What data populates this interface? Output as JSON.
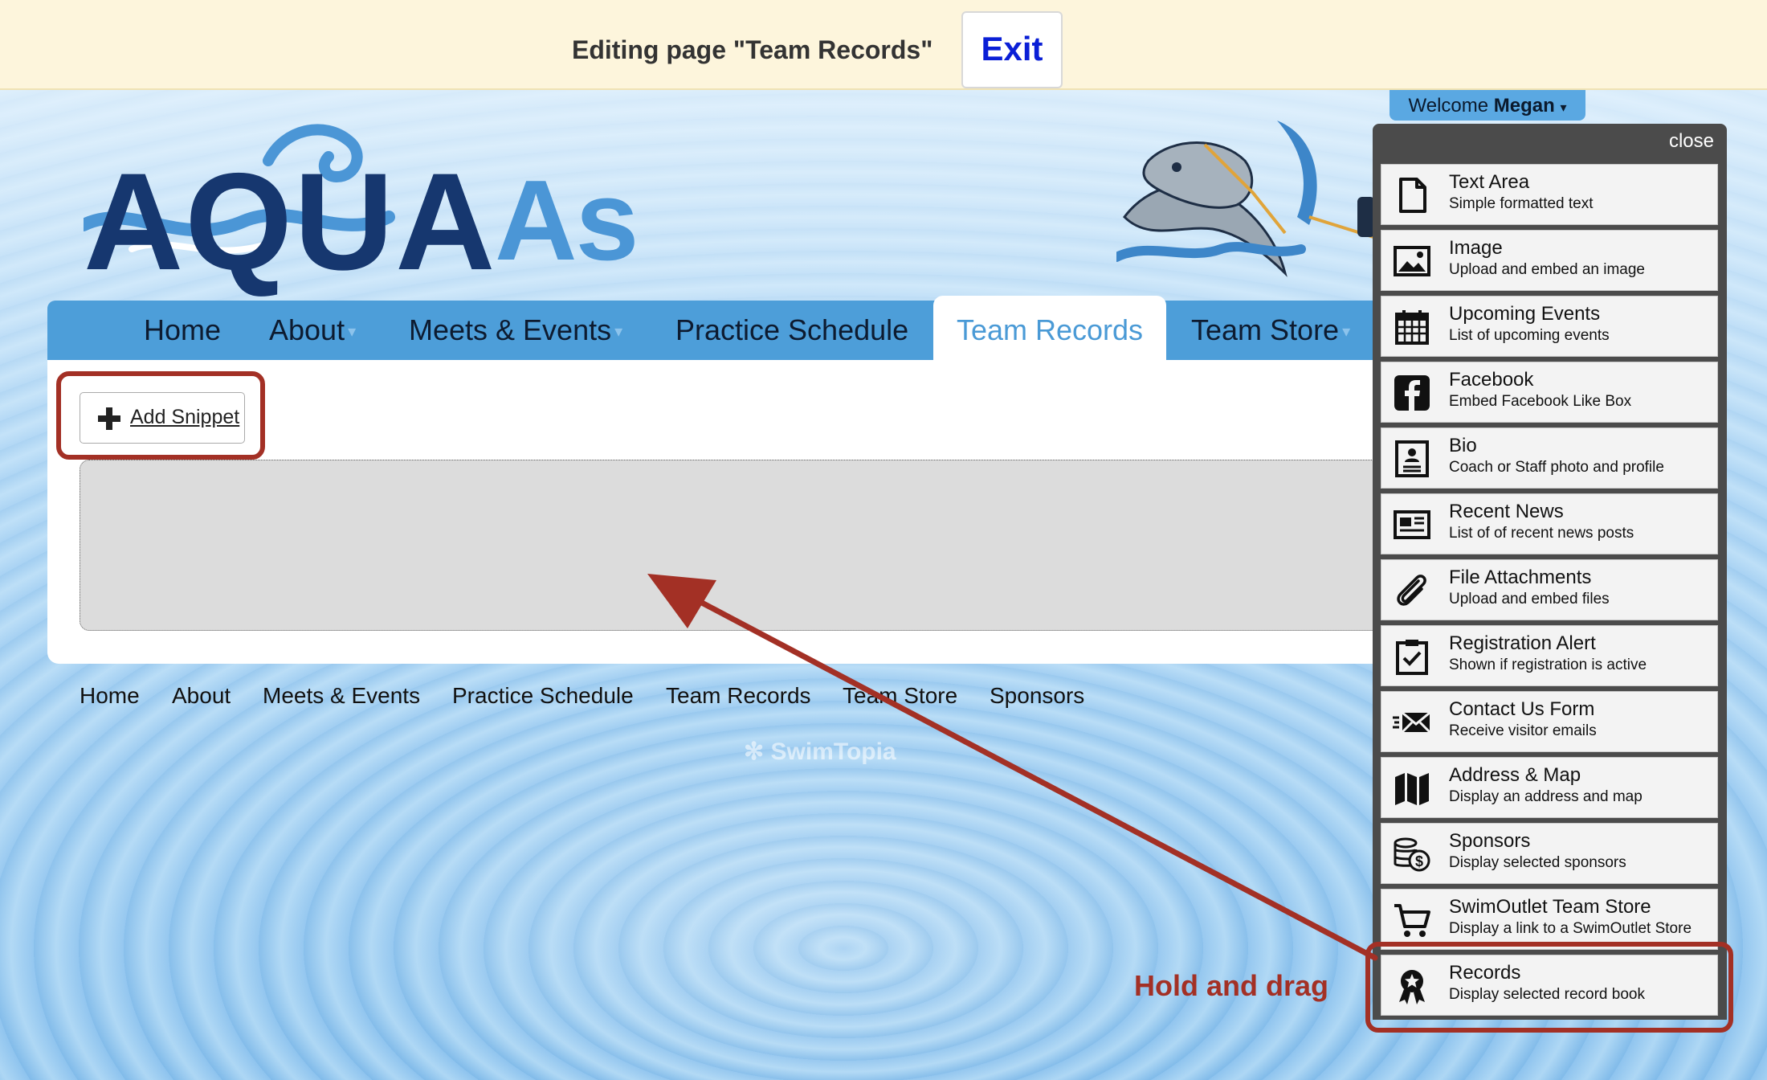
{
  "edit_bar": {
    "title": "Editing page \"Team Records\"",
    "exit_label": "Exit"
  },
  "welcome": {
    "prefix": "Welcome ",
    "user": "Megan",
    "caret": "▾"
  },
  "logo": {
    "aqua": "AQUA",
    "as": "As"
  },
  "nav": {
    "items": [
      {
        "label": "Home"
      },
      {
        "label": "About",
        "has_dropdown": true
      },
      {
        "label": "Meets & Events",
        "has_dropdown": true
      },
      {
        "label": "Practice Schedule"
      },
      {
        "label": "Team Records",
        "active": true
      },
      {
        "label": "Team Store",
        "has_dropdown": true
      }
    ],
    "caret": "▾"
  },
  "content": {
    "add_snippet_label": "Add Snippet"
  },
  "footer": {
    "links": [
      "Home",
      "About",
      "Meets & Events",
      "Practice Schedule",
      "Team Records",
      "Team Store",
      "Sponsors"
    ],
    "watermark": "SwimTopia"
  },
  "snippet_panel": {
    "close_label": "close",
    "items": [
      {
        "title": "Text Area",
        "desc": "Simple formatted text",
        "icon": "document-icon"
      },
      {
        "title": "Image",
        "desc": "Upload and embed an image",
        "icon": "image-icon"
      },
      {
        "title": "Upcoming Events",
        "desc": "List of upcoming events",
        "icon": "calendar-icon"
      },
      {
        "title": "Facebook",
        "desc": "Embed Facebook Like Box",
        "icon": "facebook-icon"
      },
      {
        "title": "Bio",
        "desc": "Coach or Staff photo and profile",
        "icon": "bio-icon"
      },
      {
        "title": "Recent News",
        "desc": "List of of recent news posts",
        "icon": "news-icon"
      },
      {
        "title": "File Attachments",
        "desc": "Upload and embed files",
        "icon": "paperclip-icon"
      },
      {
        "title": "Registration Alert",
        "desc": "Shown if registration is active",
        "icon": "clipboard-check-icon"
      },
      {
        "title": "Contact Us Form",
        "desc": "Receive visitor emails",
        "icon": "envelope-icon"
      },
      {
        "title": "Address & Map",
        "desc": "Display an address and map",
        "icon": "map-icon"
      },
      {
        "title": "Sponsors",
        "desc": "Display selected sponsors",
        "icon": "coins-icon"
      },
      {
        "title": "SwimOutlet Team Store",
        "desc": "Display a link to a SwimOutlet Store",
        "icon": "cart-icon"
      },
      {
        "title": "Records",
        "desc": "Display selected record book",
        "icon": "ribbon-icon"
      }
    ]
  },
  "annotation": {
    "hold_drag": "Hold and drag",
    "color": "#a33025"
  },
  "colors": {
    "nav_bg": "#4d9ed9",
    "active_tab_text": "#4a9ad6",
    "exit_text": "#0a1fd6",
    "edit_bar_bg": "#fdf5dc"
  }
}
